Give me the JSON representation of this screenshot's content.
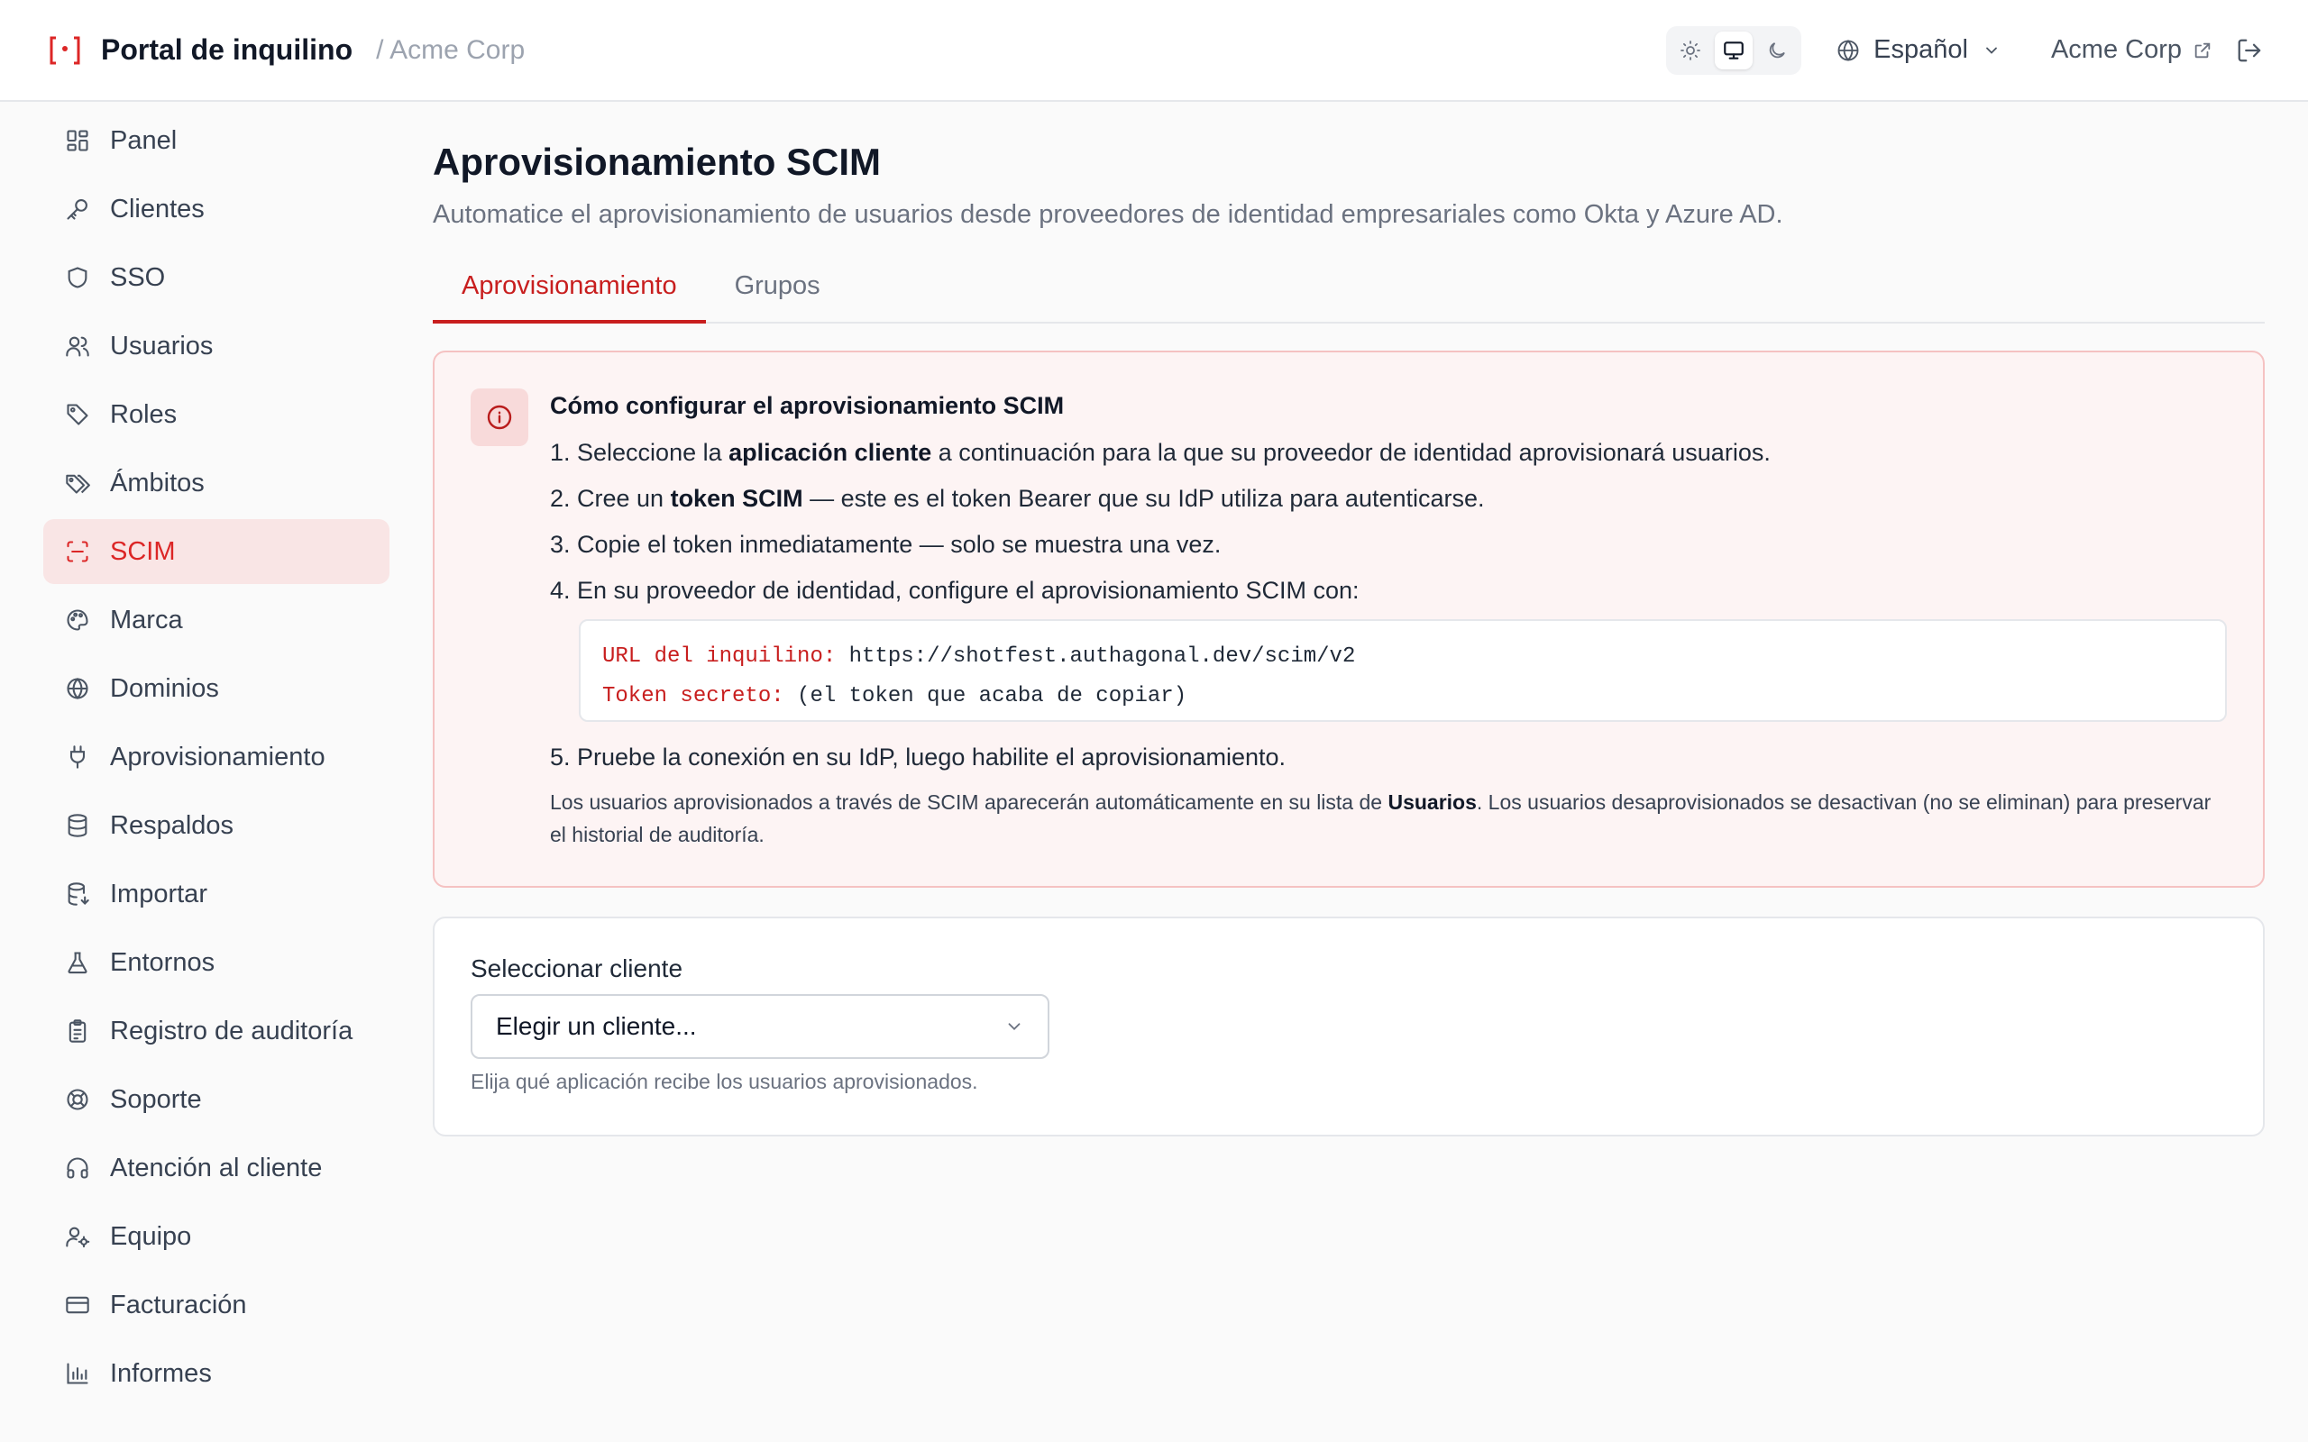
{
  "header": {
    "brand_title": "Portal de inquilino",
    "breadcrumb_org": "/ Acme Corp",
    "language": "Español",
    "org_name": "Acme Corp"
  },
  "sidebar": {
    "items": [
      {
        "label": "Panel",
        "icon": "dashboard-icon"
      },
      {
        "label": "Clientes",
        "icon": "key-icon"
      },
      {
        "label": "SSO",
        "icon": "shield-icon"
      },
      {
        "label": "Usuarios",
        "icon": "users-icon"
      },
      {
        "label": "Roles",
        "icon": "tag-icon"
      },
      {
        "label": "Ámbitos",
        "icon": "tags-icon"
      },
      {
        "label": "SCIM",
        "icon": "scan-icon",
        "active": true
      },
      {
        "label": "Marca",
        "icon": "palette-icon"
      },
      {
        "label": "Dominios",
        "icon": "globe-icon"
      },
      {
        "label": "Aprovisionamiento",
        "icon": "plug-icon"
      },
      {
        "label": "Respaldos",
        "icon": "database-icon"
      },
      {
        "label": "Importar",
        "icon": "database-import-icon"
      },
      {
        "label": "Entornos",
        "icon": "flask-icon"
      },
      {
        "label": "Registro de auditoría",
        "icon": "clipboard-icon"
      },
      {
        "label": "Soporte",
        "icon": "lifebuoy-icon"
      },
      {
        "label": "Atención al cliente",
        "icon": "headphones-icon"
      },
      {
        "label": "Equipo",
        "icon": "user-cog-icon"
      },
      {
        "label": "Facturación",
        "icon": "credit-card-icon"
      },
      {
        "label": "Informes",
        "icon": "bar-chart-icon"
      }
    ]
  },
  "main": {
    "title": "Aprovisionamiento SCIM",
    "subtitle": "Automatice el aprovisionamiento de usuarios desde proveedores de identidad empresariales como Okta y Azure AD.",
    "tabs": [
      {
        "label": "Aprovisionamiento",
        "active": true
      },
      {
        "label": "Grupos",
        "active": false
      }
    ],
    "info": {
      "title": "Cómo configurar el aprovisionamiento SCIM",
      "step1_a": "1. Seleccione la ",
      "step1_b": "aplicación cliente",
      "step1_c": " a continuación para la que su proveedor de identidad aprovisionará usuarios.",
      "step2_a": "2. Cree un ",
      "step2_b": "token SCIM",
      "step2_c": " — este es el token Bearer que su IdP utiliza para autenticarse.",
      "step3": "3. Copie el token inmediatamente — solo se muestra una vez.",
      "step4": "4. En su proveedor de identidad, configure el aprovisionamiento SCIM con:",
      "code_url_key": "URL del inquilino:",
      "code_url_val": " https://shotfest.authagonal.dev/scim/v2",
      "code_token_key": "Token secreto:",
      "code_token_val": " (el token que acaba de copiar)",
      "step5": "5. Pruebe la conexión en su IdP, luego habilite el aprovisionamiento.",
      "note_a": "Los usuarios aprovisionados a través de SCIM aparecerán automáticamente en su lista de ",
      "note_b": "Usuarios",
      "note_c": ". Los usuarios desaprovisionados se desactivan (no se eliminan) para preservar el historial de auditoría."
    },
    "client_select": {
      "label": "Seleccionar cliente",
      "value": "Elegir un cliente...",
      "hint": "Elija qué aplicación recibe los usuarios aprovisionados."
    }
  },
  "colors": {
    "accent": "#c81e1e",
    "active_bg": "#f9e5e5",
    "info_bg": "#fdf4f4",
    "info_border": "#f5c2c2"
  }
}
